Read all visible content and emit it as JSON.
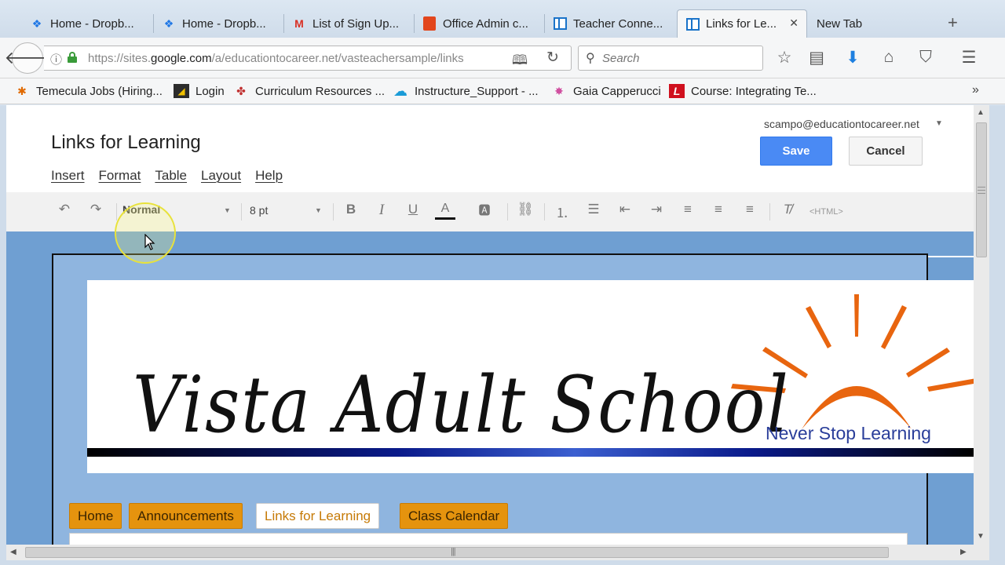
{
  "browser": {
    "tabs": [
      {
        "label": "Home - Dropb...",
        "icon": "dropbox-icon"
      },
      {
        "label": "Home - Dropb...",
        "icon": "dropbox-icon"
      },
      {
        "label": "List of Sign Up...",
        "icon": "gmail-icon"
      },
      {
        "label": "Office Admin c...",
        "icon": "office-icon"
      },
      {
        "label": "Teacher Conne...",
        "icon": "sites-icon"
      },
      {
        "label": "Links for Le...",
        "icon": "sites-icon",
        "active": true
      },
      {
        "label": "New Tab",
        "icon": ""
      }
    ],
    "url_prefix": "https://sites.",
    "url_domain": "google.com",
    "url_path": "/a/educationtocareer.net/vasteachersample/links",
    "search_placeholder": "Search",
    "bookmarks": [
      {
        "label": "Temecula Jobs (Hiring...",
        "icon": "temecula-icon"
      },
      {
        "label": "Login",
        "icon": "login-icon"
      },
      {
        "label": "Curriculum Resources ...",
        "icon": "curriculum-icon"
      },
      {
        "label": "Instructure_Support - ...",
        "icon": "salesforce-icon"
      },
      {
        "label": "Gaia Capperucci",
        "icon": "star-burst-icon"
      },
      {
        "label": "Course: Integrating Te...",
        "icon": "course-icon"
      }
    ]
  },
  "editor": {
    "account": "scampo@educationtocareer.net",
    "page_title": "Links for Learning",
    "save_label": "Save",
    "cancel_label": "Cancel",
    "menu": [
      "Insert",
      "Format",
      "Table",
      "Layout",
      "Help"
    ],
    "toolbar": {
      "style_value": "Normal",
      "size_value": "8 pt",
      "bold": "B",
      "italic": "I",
      "underline": "U",
      "text_color": "A",
      "html_label": "<HTML>"
    }
  },
  "site": {
    "banner_title": "Vista Adult School",
    "tagline": "Never Stop Learning",
    "nav": [
      {
        "label": "Home"
      },
      {
        "label": "Announcements"
      },
      {
        "label": "Links for Learning",
        "active": true
      },
      {
        "label": "Class Calendar"
      }
    ],
    "colors": {
      "background_blue": "#6f9fd2",
      "nav_orange": "#e5930e",
      "save_blue": "#4a8af4"
    }
  }
}
